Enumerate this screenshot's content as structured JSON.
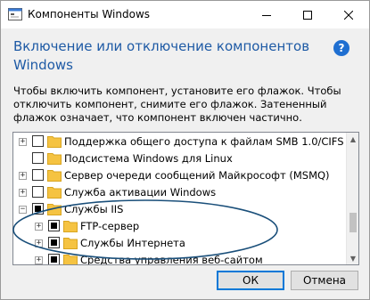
{
  "window": {
    "title": "Компоненты Windows",
    "title_icon": "windows-features-icon"
  },
  "header": {
    "heading": "Включение или отключение компонентов Windows",
    "help": "?"
  },
  "description": "Чтобы включить компонент, установите его флажок. Чтобы отключить компонент, снимите его флажок. Затененный флажок означает, что компонент включен частично.",
  "tree": {
    "items": [
      {
        "label": "Поддержка общего доступа к файлам SMB 1.0/CIFS",
        "expander": "+",
        "state": "unchecked"
      },
      {
        "label": "Подсистема Windows для Linux",
        "expander": "",
        "state": "unchecked"
      },
      {
        "label": "Сервер очереди сообщений Майкрософт (MSMQ)",
        "expander": "+",
        "state": "unchecked"
      },
      {
        "label": "Служба активации Windows",
        "expander": "+",
        "state": "unchecked"
      },
      {
        "label": "Службы IIS",
        "expander": "−",
        "state": "partial"
      },
      {
        "label": "FTP-сервер",
        "expander": "+",
        "state": "partial"
      },
      {
        "label": "Службы Интернета",
        "expander": "+",
        "state": "partial"
      },
      {
        "label": "Средства управления веб-сайтом",
        "expander": "+",
        "state": "partial"
      }
    ]
  },
  "buttons": {
    "ok": "ОК",
    "cancel": "Отмена"
  },
  "colors": {
    "heading": "#1e5aa5",
    "annotation_ellipse": "#1a4f7a",
    "folder": "#f5c342",
    "ok_focus": "#0078d7"
  }
}
